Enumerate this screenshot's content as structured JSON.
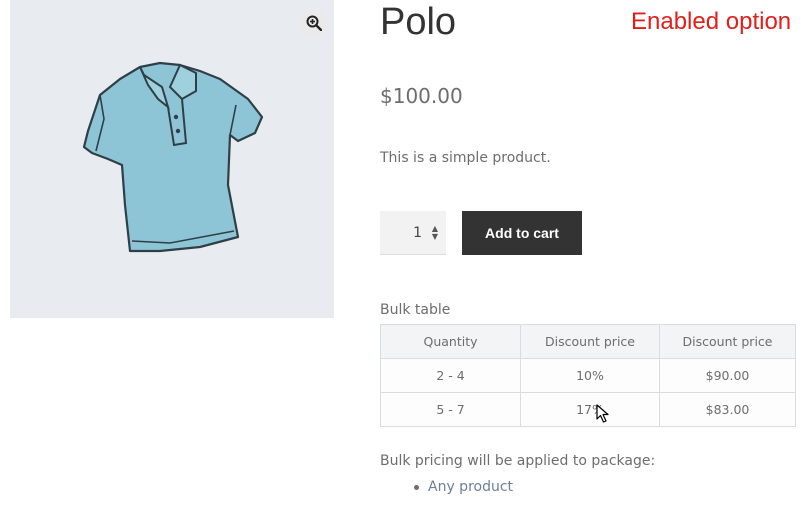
{
  "product": {
    "title": "Polo",
    "price": "$100.00",
    "description": "This is a simple product.",
    "image_icon": "polo-shirt-icon",
    "zoom_icon": "magnify-plus-icon"
  },
  "annotation": {
    "label": "Enabled option",
    "color": "#e0201b"
  },
  "cart": {
    "quantity": "1",
    "add_label": "Add to cart"
  },
  "bulk": {
    "title": "Bulk table",
    "headers": [
      "Quantity",
      "Discount price",
      "Discount price"
    ],
    "rows": [
      [
        "2 - 4",
        "10%",
        "$90.00"
      ],
      [
        "5 - 7",
        "17%",
        "$83.00"
      ]
    ],
    "note": "Bulk pricing will be applied to package:",
    "items": [
      "Any product"
    ]
  },
  "colors": {
    "button_bg": "#333333",
    "link": "#6d7e9b",
    "image_bg": "#e8ecf0"
  }
}
